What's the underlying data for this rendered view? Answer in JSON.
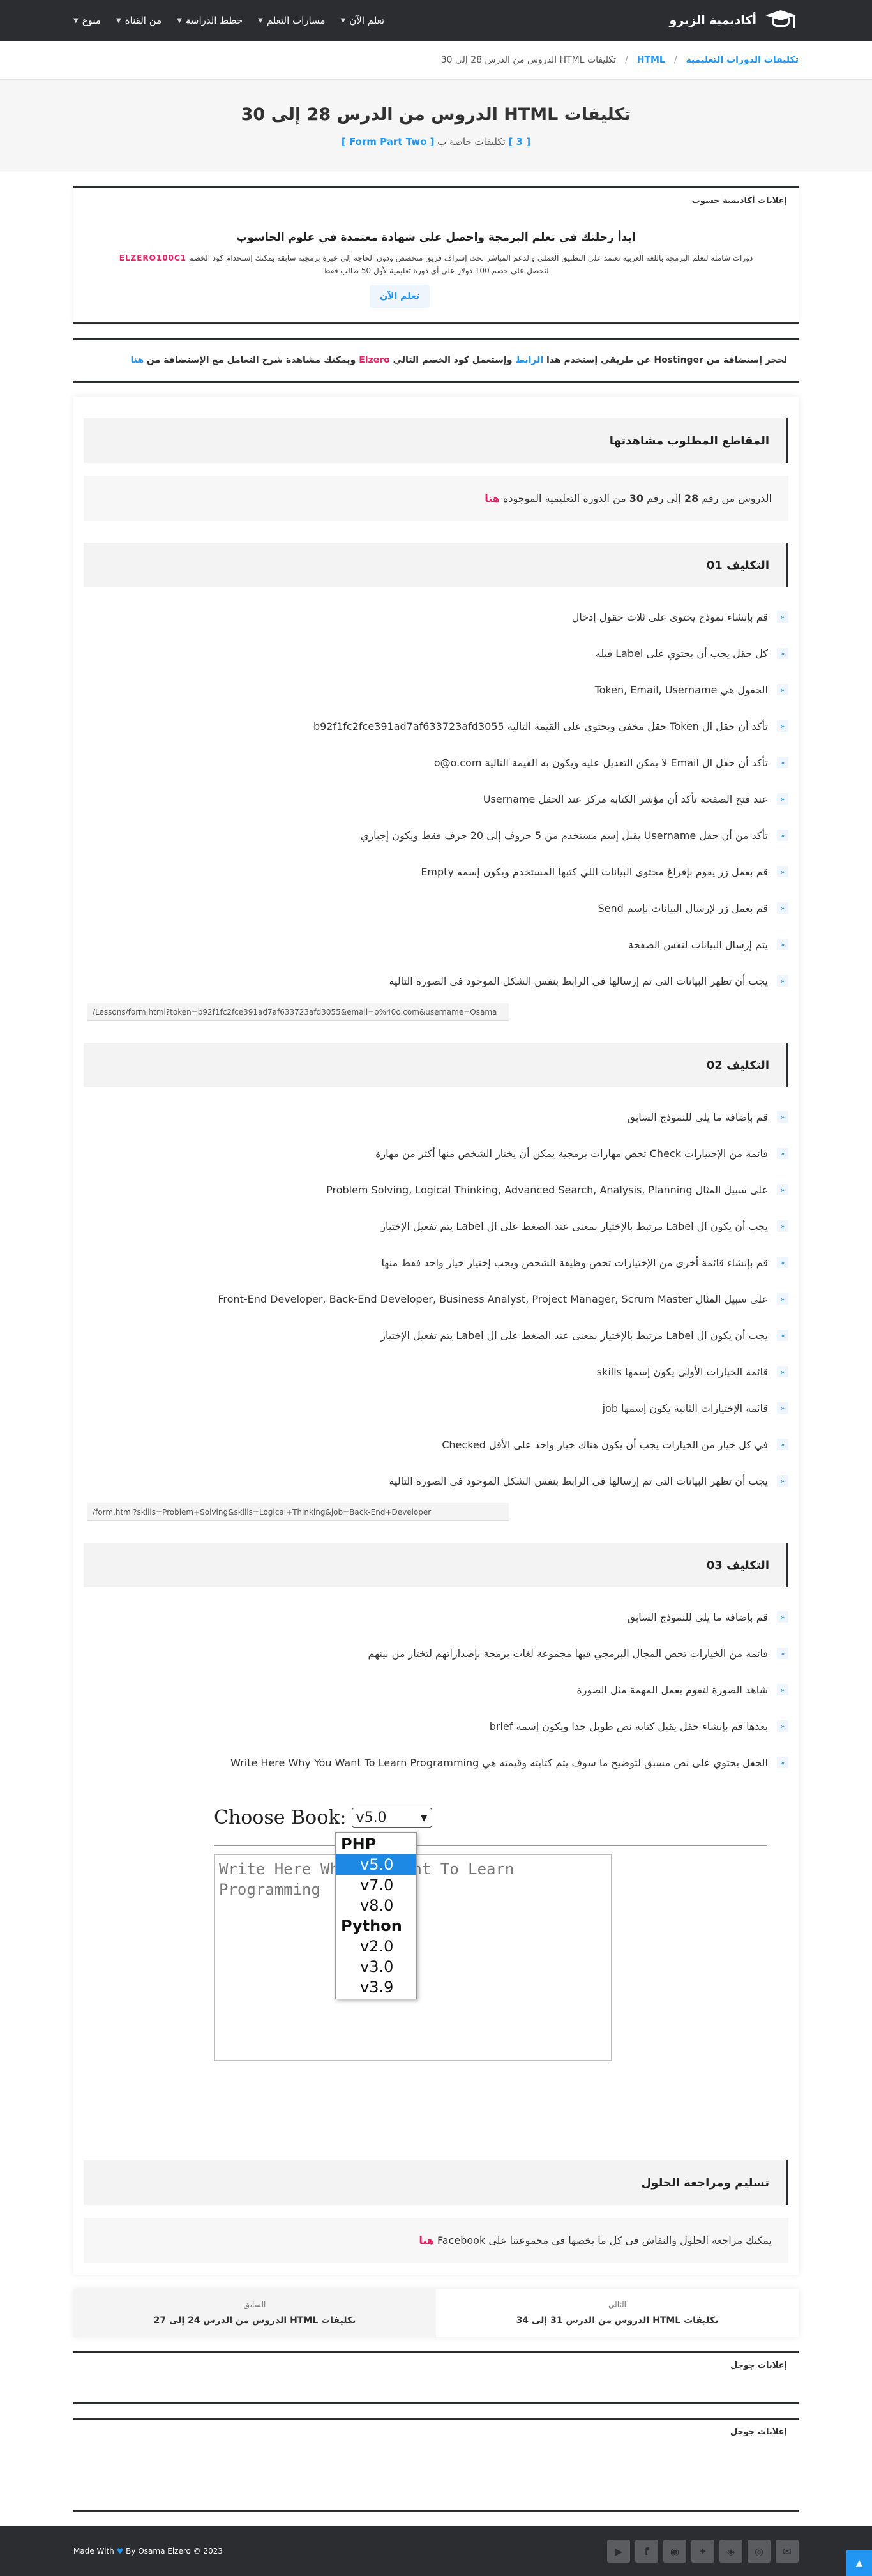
{
  "topbar": {
    "logo_text": "أكاديمية الزيرو",
    "nav": [
      "تعلم الآن",
      "مسارات التعلم",
      "خطط الدراسة",
      "من القناة",
      "منوع"
    ]
  },
  "breadcrumb": {
    "items": [
      "تكليفات الدورات التعليمية",
      "HTML",
      "تكليفات HTML الدروس من الدرس 28 إلى 30"
    ],
    "separator": "/"
  },
  "hero": {
    "title": "تكليفات HTML الدروس من الدرس 28 إلى 30",
    "sub_prefix": "[ 3 ]",
    "sub_mid": " تكليفات خاصة ب ",
    "sub_tag": "[ Form Part Two ]"
  },
  "academy_ad": {
    "label": "إعلانات أكاديمية حسوب",
    "headline": "ابدأ رحلتك في تعلم البرمجة واحصل على شهادة معتمدة في علوم الحاسوب",
    "desc_line1_a": "دورات شاملة لتعلم البرمجة باللغة العربية تعتمد على التطبيق العملي والدعم المباشر تحت إشراف فريق متخصص ودون الحاجة إلى خبرة برمجية سابقة بمكنك إستخدام كود الخصم",
    "code": "ELZERO100C1",
    "desc_line2": "لتحصل على خصم 100 دولار على أي دورة تعليمية لأول 50 طالب فقط",
    "button": "تعلم الآن"
  },
  "hosting": {
    "a": "لحجز إستضافة من Hostinger عن طريقي إستخدم هذا ",
    "link": "الرابط",
    "b": " وإستعمل كود الخصم التالي ",
    "code": "Elzero",
    "c": " ويمكنك مشاهدة شرح التعامل مع الإستضافة من ",
    "here": "هنا"
  },
  "sections": {
    "watch": {
      "title": "المقاطع المطلوب مشاهدتها",
      "note_a": "الدروس من رقم ",
      "from": "28",
      "note_b": " إلى رقم ",
      "to": "30",
      "note_c": " من الدورة التعليمية الموجودة ",
      "here": "هنا"
    },
    "task1": {
      "title": "التكليف 01",
      "items": [
        "قم بإنشاء نموذج يحتوى على ثلاث حقول إدخال",
        "كل حقل يجب أن يحتوي على Label قبله",
        "الحقول هي Token, Email, Username",
        "تأكد أن حقل ال Token حقل مخفي ويحتوي على القيمة التالية b92f1fc2fce391ad7af633723afd3055",
        "تأكد أن حقل ال Email لا يمكن التعديل عليه ويكون به القيمة التالية o@o.com",
        "عند فتح الصفحة تأكد أن مؤشر الكتابة مركز عند الحقل Username",
        "تأكد من أن حقل Username يقبل إسم مستخدم من 5 حروف إلى 20 حرف فقط ويكون إجباري",
        "قم بعمل زر يقوم بإفراغ محتوى البيانات اللي كتبها المستخدم ويكون إسمه Empty",
        "قم بعمل زر لإرسال البيانات بإسم Send",
        "يتم إرسال البيانات لنفس الصفحة",
        "يجب أن تظهر البيانات التي تم إرسالها في الرابط بنفس الشكل الموجود في الصورة التالية"
      ],
      "url": "/Lessons/form.html?token=b92f1fc2fce391ad7af633723afd3055&email=o%40o.com&username=Osama"
    },
    "task2": {
      "title": "التكليف 02",
      "items": [
        "قم بإضافة ما يلي للنموذج السابق",
        "قائمة من الإختيارات Check تخص مهارات برمجية يمكن أن يختار الشخص منها أكثر من مهارة",
        "على سبيل المثال Problem Solving, Logical Thinking, Advanced Search, Analysis, Planning",
        "يجب أن يكون ال Label مرتبط بالإختيار بمعنى عند الضغط على ال Label يتم تفعيل الإختيار",
        "قم بإنشاء قائمة أخرى من الإختيارات تخص وظيفة الشخص ويجب إختيار خيار واحد فقط منها",
        "على سبيل المثال Front-End Developer, Back-End Developer, Business Analyst, Project Manager, Scrum Master",
        "يجب أن يكون ال Label مرتبط بالإختيار بمعنى عند الضغط على ال Label يتم تفعيل الإختيار",
        "قائمة الخيارات الأولى يكون إسمها skills",
        "قائمة الإختيارات الثانية يكون إسمها job",
        "في كل خيار من الخيارات يجب أن يكون هناك خيار واحد على الأقل Checked",
        "يجب أن تظهر البيانات التي تم إرسالها في الرابط بنفس الشكل الموجود في الصورة التالية"
      ],
      "url": "/form.html?skills=Problem+Solving&skills=Logical+Thinking&job=Back-End+Developer"
    },
    "task3": {
      "title": "التكليف 03",
      "items": [
        "قم بإضافة ما يلي للنموذج السابق",
        "قائمة من الخيارات تخص المجال البرمجي فيها مجموعة لغات برمجة بإصداراتهم لتختار من بينهم",
        "شاهد الصورة لتقوم بعمل المهمة مثل الصورة",
        "بعدها قم بإنشاء حقل يقبل كتابة نص طويل جدا ويكون إسمه brief",
        "الحقل يحتوي على نص مسبق لتوضيح ما سوف يتم كتابته وقيمته هي Write Here Why You Want To Learn Programming"
      ]
    },
    "form_image": {
      "label": "Choose Book:",
      "selected": "v5.0",
      "textarea": "Write Here Why You Want To Learn\nProgramming",
      "groups": [
        {
          "name": "PHP",
          "options": [
            "v5.0",
            "v7.0",
            "v8.0"
          ]
        },
        {
          "name": "Python",
          "options": [
            "v2.0",
            "v3.0",
            "v3.9"
          ]
        }
      ]
    },
    "review": {
      "title": "تسليم ومراجعة الحلول",
      "note_a": "يمكنك مراجعة الحلول والنقاش في كل ما يخصها في مجموعتنا على Facebook ",
      "here": "هنا"
    }
  },
  "post_nav": {
    "prev_label": "السابق",
    "prev_title": "تكليفات HTML الدروس من الدرس 24 إلى 27",
    "next_label": "التالي",
    "next_title": "تكليفات HTML الدروس من الدرس 31 إلى 34"
  },
  "google_ads": {
    "label1": "إعلانات جوجل",
    "label2": "إعلانات جوجل"
  },
  "footer": {
    "made_prefix": "Made With ",
    "heart": "♥",
    "made_suffix": " By Osama Elzero © 2023",
    "socials": [
      "youtube-icon",
      "facebook-icon",
      "github-icon",
      "twitter-icon",
      "codepen-icon",
      "instagram-icon",
      "email-icon"
    ]
  }
}
